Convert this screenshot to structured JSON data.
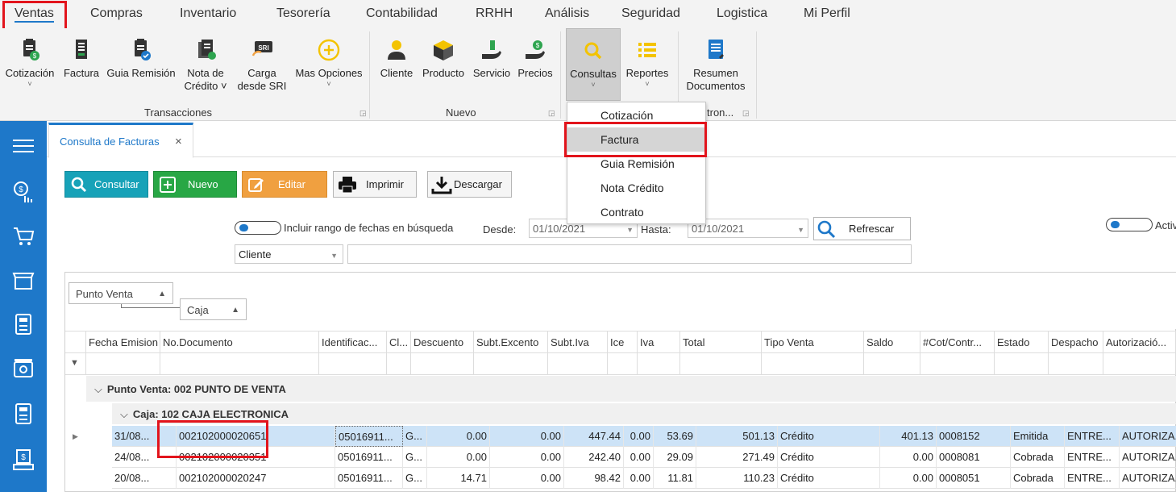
{
  "menu": [
    "Ventas",
    "Compras",
    "Inventario",
    "Tesorería",
    "Contabilidad",
    "RRHH",
    "Análisis",
    "Seguridad",
    "Logistica",
    "Mi Perfil"
  ],
  "ribbon": {
    "transacciones": {
      "label": "Transacciones",
      "buttons": [
        {
          "l1": "Cotización",
          "l2": "",
          "chev": true
        },
        {
          "l1": "Factura",
          "l2": "",
          "chev": false
        },
        {
          "l1": "Guia Remisión",
          "l2": "",
          "chev": false
        },
        {
          "l1": "Nota de",
          "l2": "Crédito ˅",
          "chev": false
        },
        {
          "l1": "Carga",
          "l2": "desde SRI",
          "chev": false
        },
        {
          "l1": "Mas Opciones",
          "l2": "",
          "chev": true
        }
      ]
    },
    "nuevo": {
      "label": "Nuevo",
      "buttons": [
        {
          "l1": "Cliente"
        },
        {
          "l1": "Producto"
        },
        {
          "l1": "Servicio"
        },
        {
          "l1": "Precios"
        }
      ]
    },
    "consultas": {
      "l1": "Consultas"
    },
    "reportes": {
      "l1": "Reportes"
    },
    "resumen": {
      "l1": "Resumen",
      "l2": "Documentos"
    },
    "group3_label": "tron..."
  },
  "dropdown": [
    "Cotización",
    "Factura",
    "Guia Remisión",
    "Nota Crédito",
    "Contrato"
  ],
  "tab": {
    "label": "Consulta de Facturas",
    "close": "×"
  },
  "toolbar": {
    "consultar": "Consultar",
    "nuevo": "Nuevo",
    "editar": "Editar",
    "imprimir": "Imprimir",
    "descargar": "Descargar"
  },
  "filters": {
    "rango_label": "Incluir rango de fechas en búsqueda",
    "desde_label": "Desde:",
    "desde_value": "01/10/2021",
    "hasta_label": "Hasta:",
    "hasta_value": "01/10/2021",
    "refrescar": "Refrescar",
    "activo_label": "Activ",
    "cliente_select": "Cliente",
    "search_value": ""
  },
  "grid": {
    "group_chips": [
      "Punto Venta",
      "Caja"
    ],
    "columns": [
      "Fecha Emision",
      "No.Documento",
      "Identificac...",
      "Cl...",
      "Descuento",
      "Subt.Excento",
      "Subt.Iva",
      "Ice",
      "Iva",
      "Total",
      "Tipo Venta",
      "Saldo",
      "#Cot/Contr...",
      "Estado",
      "Despacho",
      "Autorizació..."
    ],
    "group1": "Punto Venta: 002 PUNTO DE VENTA",
    "group2": "Caja: 102 CAJA ELECTRONICA",
    "rows": [
      [
        "31/08...",
        "002102000020651",
        "05016911...",
        "G...",
        "0.00",
        "0.00",
        "447.44",
        "0.00",
        "53.69",
        "501.13",
        "Crédito",
        "401.13",
        "0008152",
        "Emitida",
        "ENTRE...",
        "AUTORIZA..."
      ],
      [
        "24/08...",
        "002102000020351",
        "05016911...",
        "G...",
        "0.00",
        "0.00",
        "242.40",
        "0.00",
        "29.09",
        "271.49",
        "Crédito",
        "0.00",
        "0008081",
        "Cobrada",
        "ENTRE...",
        "AUTORIZA..."
      ],
      [
        "20/08...",
        "002102000020247",
        "05016911...",
        "G...",
        "14.71",
        "0.00",
        "98.42",
        "0.00",
        "11.81",
        "110.23",
        "Crédito",
        "0.00",
        "0008051",
        "Cobrada",
        "ENTRE...",
        "AUTORIZA..."
      ]
    ]
  },
  "colors": {
    "accent": "#1e78c9",
    "consultar": "#17a2b8",
    "nuevo": "#28a745",
    "editar": "#f0a040",
    "highlight": "#e2141c",
    "selected_row": "#cde3f7"
  }
}
